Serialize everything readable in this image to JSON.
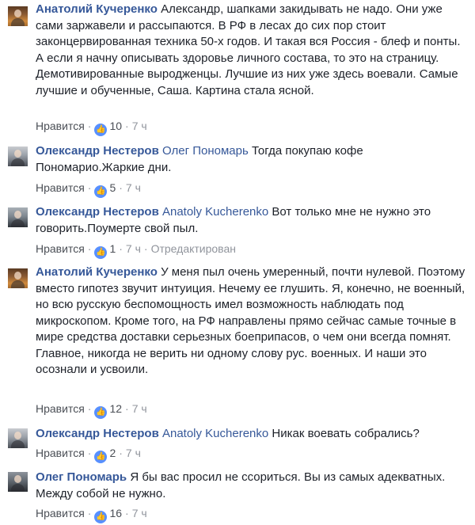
{
  "comments": [
    {
      "author": "Анатолий Кучеренко",
      "text": "Александр, шапками закидывать не надо. Они уже сами заржавели и рассыпаются. В РФ в лесах до сих пор стоит законцервированная техника 50-х годов. И такая вся Россия - блеф и понты. А если я начну описывать здоровье личного состава, то это на страницу. Демотивированные выродженцы. Лучшие из них уже здесь воевали. Самые лучшие и обученные, Саша. Картина стала ясной.",
      "like_label": "Нравится",
      "likes": "10",
      "time": "7 ч"
    },
    {
      "author": "Олександр Нестеров",
      "mention": "Олег Пономарь",
      "text": "Тогда покупаю кофе Пономарио.Жаркие дни.",
      "like_label": "Нравится",
      "likes": "5",
      "time": "7 ч"
    },
    {
      "author": "Олександр Нестеров",
      "mention": "Anatoly Kucherenko",
      "text": "Вот только мне не нужно это говорить.Поумерте свой пыл.",
      "like_label": "Нравится",
      "likes": "1",
      "time": "7 ч",
      "edited": "Отредактирован"
    },
    {
      "author": "Анатолий Кучеренко",
      "text": "У меня пыл очень умеренный, почти нулевой. Поэтому вместо гипотез звучит интуиция. Нечему ее глушить. Я, конечно, не военный, но всю русскую беспомощность имел возможность наблюдать под микроскопом. Кроме того, на РФ направлены прямо сейчас самые точные в мире средства доставки серьезных боеприпасов, о чем они всегда помнят. Главное, никогда не верить ни одному слову рус. военных. И наши это осознали и усвоили.",
      "like_label": "Нравится",
      "likes": "12",
      "time": "7 ч"
    },
    {
      "author": "Олександр Нестеров",
      "mention": "Anatoly Kucherenko",
      "text": "Никак воевать собрались?",
      "like_label": "Нравится",
      "likes": "2",
      "time": "7 ч"
    },
    {
      "author": "Олег Пономарь",
      "text": "Я бы вас просил не ссориться. Вы из самых адекватных. Между собой не нужно.",
      "like_label": "Нравится",
      "likes": "16",
      "time": "7 ч"
    }
  ],
  "like_icon": "thumbs-up-icon",
  "colors": {
    "author": "#365899",
    "meta": "#90949c",
    "like_badge": "#5890ff"
  }
}
